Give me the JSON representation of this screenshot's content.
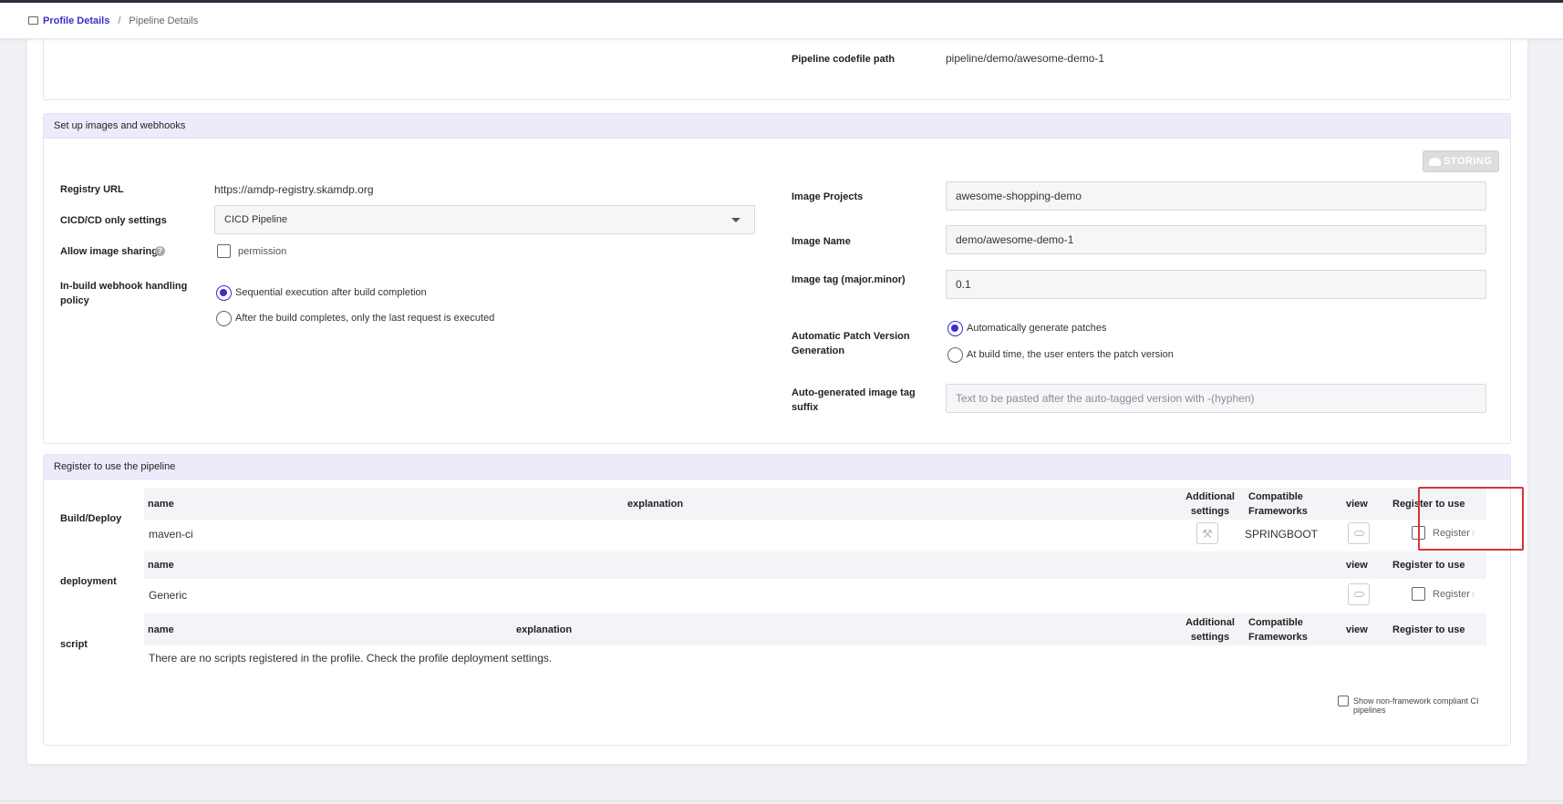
{
  "breadcrumb": {
    "link": "Profile Details",
    "separator": "/",
    "current": "Pipeline Details"
  },
  "pipeline": {
    "codefile_label": "Pipeline codefile path",
    "codefile_value": "pipeline/demo/awesome-demo-1"
  },
  "images_section": {
    "title": "Set up images and webhooks",
    "storing_button": "STORING",
    "registry_url_label": "Registry URL",
    "registry_url_value": "https://amdp-registry.skamdp.org",
    "cicd_label": "CICD/CD only settings",
    "cicd_value": "CICD Pipeline",
    "image_sharing_label": "Allow image sharing",
    "image_sharing_checkbox": "permission",
    "webhook_label": "In-build webhook handling policy",
    "webhook_option1": "Sequential execution after build completion",
    "webhook_option2": "After the build completes, only the last request is executed",
    "image_projects_label": "Image Projects",
    "image_projects_value": "awesome-shopping-demo",
    "image_name_label": "Image Name",
    "image_name_value": "demo/awesome-demo-1",
    "image_tag_label": "Image tag (major.minor)",
    "image_tag_value": "0.1",
    "patch_label": "Automatic Patch Version Generation",
    "patch_option1": "Automatically generate patches",
    "patch_option2": "At build time, the user enters the patch version",
    "suffix_label": "Auto-generated image tag suffix",
    "suffix_placeholder": "Text to be pasted after the auto-tagged version with -(hyphen)"
  },
  "register_section": {
    "title": "Register to use the pipeline",
    "build_label": "Build/Deploy",
    "deployment_label": "deployment",
    "script_label": "script",
    "headers": {
      "name": "name",
      "explanation": "explanation",
      "additional": "Additional settings",
      "frameworks": "Compatible Frameworks",
      "view": "view",
      "register": "Register to use"
    },
    "build_row": {
      "name": "maven-ci",
      "framework": "SPRINGBOOT",
      "register_label": "Register n"
    },
    "deploy_row": {
      "name": "Generic",
      "register_label": "Register n"
    },
    "script_empty": "There are no scripts registered in the profile. Check the profile deployment settings.",
    "non_framework_label": "Show non-framework compliant CI pipelines"
  }
}
